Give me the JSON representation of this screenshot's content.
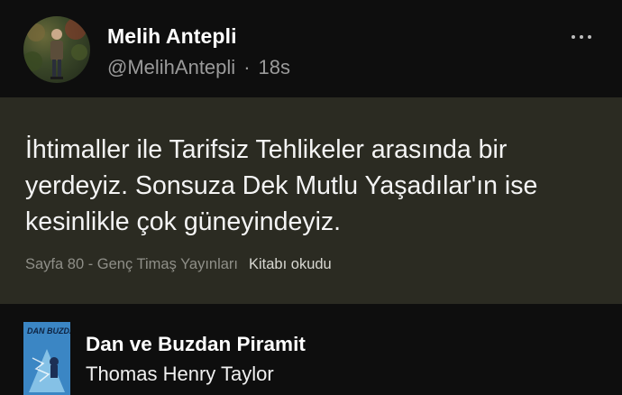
{
  "post": {
    "author_name": "Melih Antepli",
    "handle": "@MelihAntepli",
    "separator": "·",
    "timestamp": "18s",
    "more_icon": "more-horizontal-icon"
  },
  "quote": {
    "text": "İhtimaller ile Tarifsiz Tehlikeler arasında bir yerdeyiz. Sonsuza Dek Mutlu Yaşadılar'ın ise kesinlikle çok güneyindeyiz.",
    "source": "Sayfa 80 - Genç Timaş Yayınları",
    "action": "Kitabı okudu",
    "background_color": "#2b2b22"
  },
  "book": {
    "title": "Dan ve Buzdan Piramit",
    "author": "Thomas Henry Taylor",
    "cover_text": "DAN BUZDAN"
  },
  "colors": {
    "background": "#0e0e0e",
    "secondary_text": "#9a9a9a"
  }
}
